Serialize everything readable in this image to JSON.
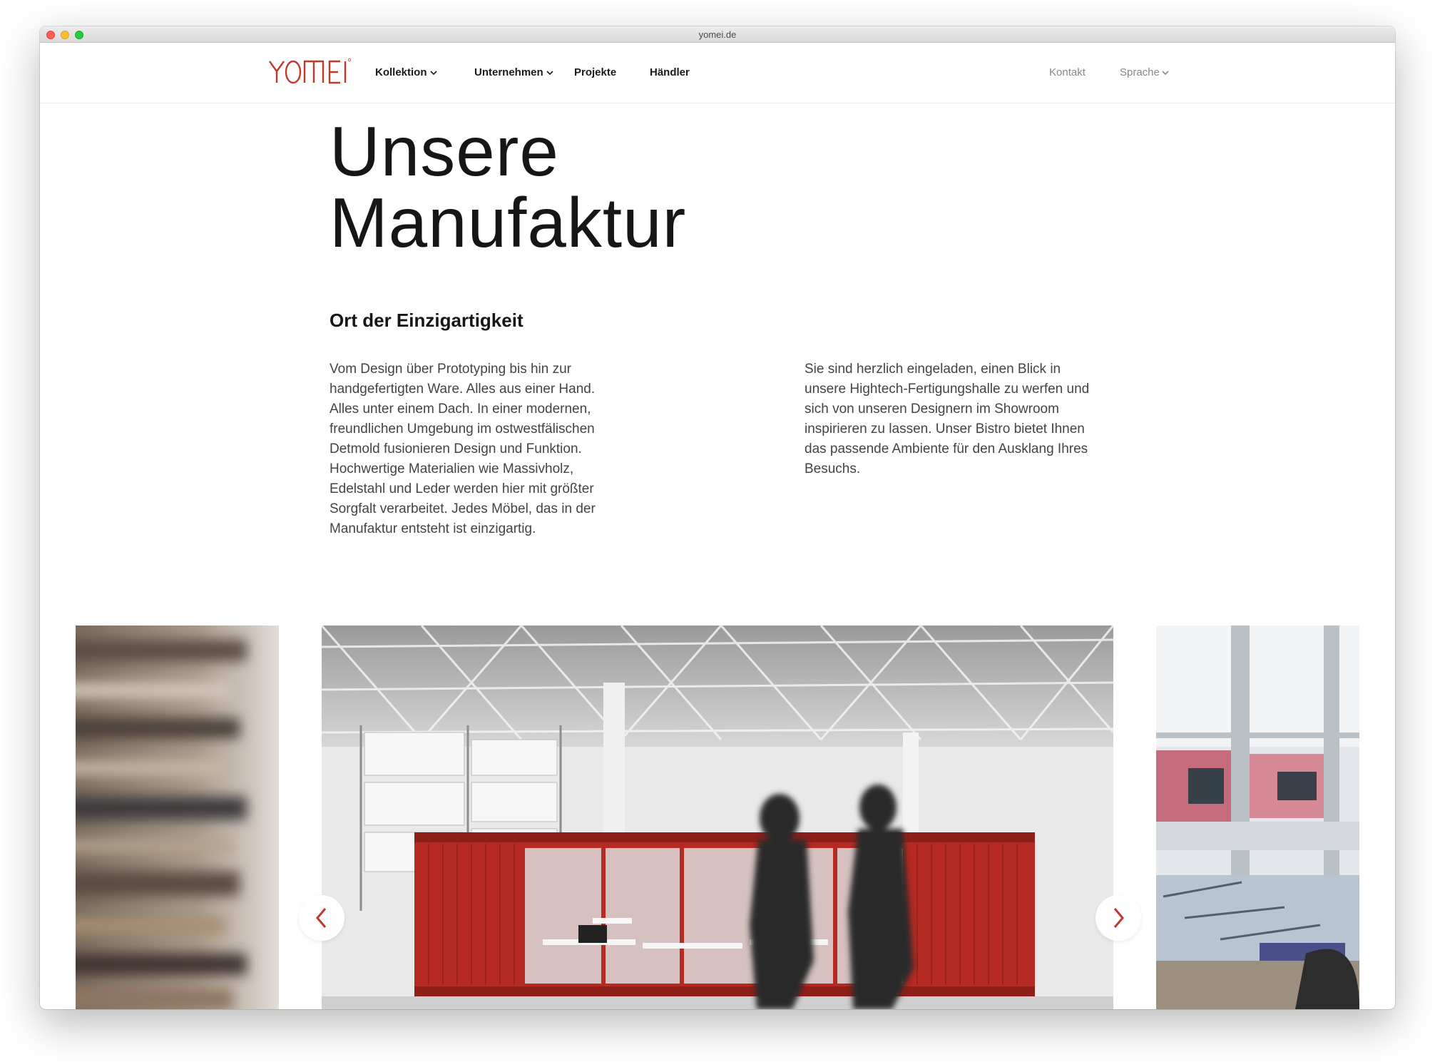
{
  "browser": {
    "url": "yomei.de"
  },
  "header": {
    "logo_text": "YOMEI",
    "nav": [
      {
        "label": "Kollektion",
        "has_dropdown": true
      },
      {
        "label": "Unternehmen",
        "has_dropdown": true
      },
      {
        "label": "Projekte",
        "has_dropdown": false
      },
      {
        "label": "Händler",
        "has_dropdown": false
      }
    ],
    "contact_label": "Kontakt",
    "language_label": "Sprache"
  },
  "main": {
    "title_line1": "Unsere",
    "title_line2": "Manufaktur",
    "subheading": "Ort der Einzigartigkeit",
    "paragraph_left": "Vom Design über Prototyping bis hin zur handgefertigten Ware. Alles aus einer Hand. Alles unter einem Dach. In einer modernen, freundlichen Umgebung im ostwestfälischen Detmold fusionieren Design und Funktion. Hochwertige Materialien wie Massivholz, Edelstahl und Leder werden hier mit größter Sorgfalt verarbeitet. Jedes Möbel, das in der Manufaktur entsteht ist einzigartig.",
    "paragraph_right": "Sie sind herzlich eingeladen, einen Blick in unsere Hightech-Fertigungshalle zu werfen und sich von unseren Designern im Showroom inspirieren zu lassen. Unser Bistro bietet Ihnen das passende Ambiente für den Ausklang Ihres Besuchs."
  },
  "carousel": {
    "slides": [
      "blurred-wood-stack-photo",
      "factory-hall-red-container-photo",
      "workshop-window-photo"
    ],
    "prev_icon": "chevron-left-icon",
    "next_icon": "chevron-right-icon"
  },
  "colors": {
    "brand": "#c0392b",
    "text": "#161616",
    "muted": "#888888",
    "container_red": "#b52a22"
  }
}
